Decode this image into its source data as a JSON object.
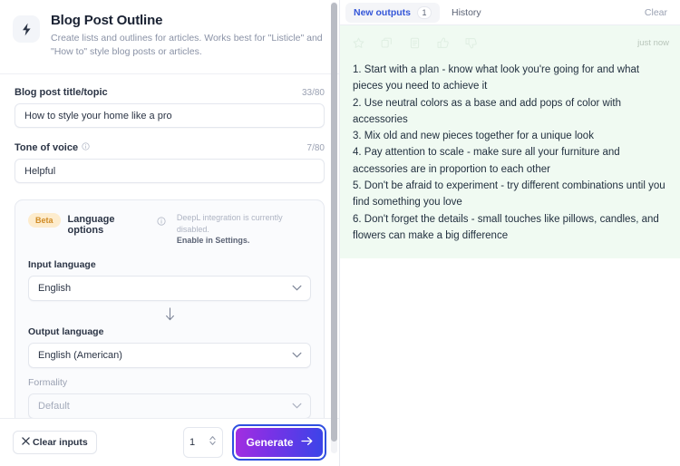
{
  "tool": {
    "icon": "lightning-bolt-icon",
    "title": "Blog Post Outline",
    "description": "Create lists and outlines for articles. Works best for \"Listicle\" and \"How to\" style blog posts or articles."
  },
  "form": {
    "title_field": {
      "label": "Blog post title/topic",
      "counter": "33/80",
      "value": "How to style your home like a pro",
      "placeholder": "How to style your home like a pro"
    },
    "tone_field": {
      "label": "Tone of voice",
      "counter": "7/80",
      "value": "Helpful",
      "placeholder": "Helpful"
    },
    "language_options": {
      "badge": "Beta",
      "title": "Language options",
      "note_line1": "DeepL integration is currently disabled.",
      "note_line2": "Enable in Settings.",
      "input_language_label": "Input language",
      "input_language_value": "English",
      "output_language_label": "Output language",
      "output_language_value": "English (American)",
      "formality_label": "Formality",
      "formality_value": "Default"
    }
  },
  "footer": {
    "clear_inputs_label": "Clear inputs",
    "count_value": "1",
    "generate_label": "Generate"
  },
  "output_panel": {
    "tabs": [
      {
        "label": "New outputs",
        "badge": "1"
      },
      {
        "label": "History",
        "badge": ""
      }
    ],
    "clear_label": "Clear",
    "result": {
      "timestamp": "just now",
      "actions": [
        "star-icon",
        "copy-icon",
        "document-icon",
        "thumbs-up-icon",
        "thumbs-down-icon"
      ],
      "text": "1. Start with a plan - know what look you're going for and what pieces you need to achieve it\n2. Use neutral colors as a base and add pops of color with accessories\n3. Mix old and new pieces together for a unique look\n4. Pay attention to scale - make sure all your furniture and accessories are in proportion to each other\n5. Don't be afraid to experiment - try different combinations until you find something you love\n6. Don't forget the details - small touches like pillows, candles, and flowers can make a big difference"
    }
  },
  "colors": {
    "accent_blue": "#3557d8",
    "gradient_start": "#a32ee0",
    "gradient_end": "#3a44e8",
    "beta_badge_bg": "#fdeccd",
    "beta_badge_text": "#d08b25",
    "output_card_bg": "#f0faf2"
  }
}
